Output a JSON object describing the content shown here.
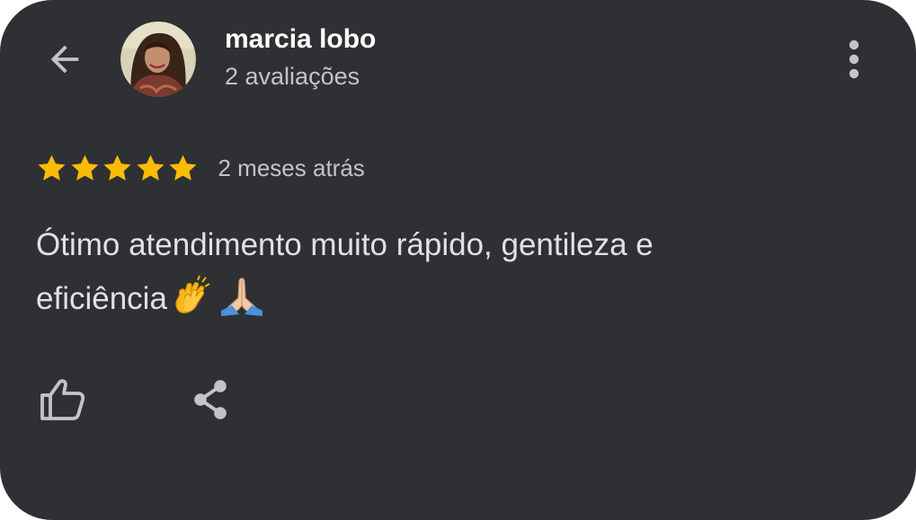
{
  "reviewer": {
    "name": "marcia lobo",
    "review_count": "2 avaliações",
    "avatar_icon": "profile-photo"
  },
  "review": {
    "rating": 5,
    "rating_max": 5,
    "time_ago": "2 meses atrás",
    "text_line1": "Ótimo atendimento muito rápido, gentileza e",
    "text_line2": "eficiência",
    "emojis": [
      "clapping-hands",
      "folded-hands"
    ]
  },
  "actions": {
    "back_icon": "arrow-back-icon",
    "menu_icon": "more-vert-icon",
    "like_icon": "thumb-up-icon",
    "share_icon": "share-icon"
  },
  "colors": {
    "background": "#2f3033",
    "star": "#fbbc04",
    "primary_text": "#ffffff",
    "secondary_text": "#c3c4c8",
    "icon": "#c3c4c8"
  }
}
